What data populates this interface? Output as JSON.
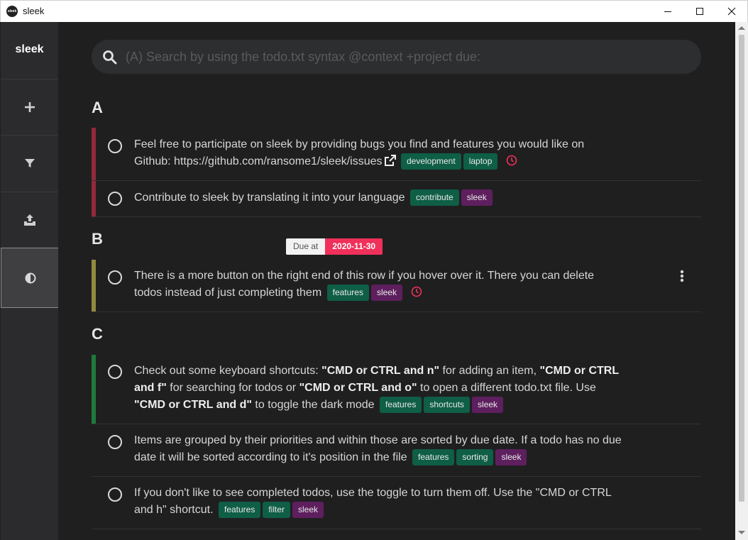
{
  "window": {
    "title": "sleek",
    "icon_label": "sleek"
  },
  "sidebar": {
    "brand": "sleek",
    "buttons": [
      {
        "name": "add",
        "icon": "plus-icon"
      },
      {
        "name": "filter",
        "icon": "funnel-icon"
      },
      {
        "name": "upload",
        "icon": "upload-icon"
      },
      {
        "name": "theme",
        "icon": "contrast-icon",
        "active": true
      }
    ]
  },
  "search": {
    "placeholder": "(A) Search by using the todo.txt syntax @context +project due:"
  },
  "groups": [
    {
      "priority": "A",
      "color": "#922a3c",
      "items": [
        {
          "text": "Feel free to participate on sleek by providing bugs you find and features you would like on Github: https://github.com/ransome1/sleek/issues",
          "contexts": [
            "development",
            "laptop"
          ],
          "projects": [],
          "has_link": true,
          "has_due": true
        },
        {
          "text": "Contribute to sleek by translating it into your language",
          "contexts": [
            "contribute"
          ],
          "projects": [
            "sleek"
          ]
        }
      ]
    },
    {
      "priority": "B",
      "color": "#928a40",
      "items": [
        {
          "text": "There is a more button on the right end of this row if you hover over it. There you can delete todos instead of just completing them",
          "contexts": [
            "features"
          ],
          "projects": [
            "sleek"
          ],
          "has_due": true,
          "hovered": true
        }
      ]
    },
    {
      "priority": "C",
      "color": "#1e7a3c",
      "items": [
        {
          "text_parts": [
            "Check out some keyboard shortcuts: ",
            "\"CMD or CTRL and n\"",
            " for adding an item, ",
            "\"CMD or CTRL and f\"",
            " for searching for todos or ",
            "\"CMD or CTRL and o\"",
            " to open a different todo.txt file. Use ",
            "\"CMD or CTRL and d\"",
            " to toggle the dark mode"
          ],
          "contexts": [
            "features",
            "shortcuts"
          ],
          "projects": [
            "sleek"
          ]
        },
        {
          "text": "Items are grouped by their priorities and within those are sorted by due date. If a todo has no due date it will be sorted according to it's position in the file",
          "contexts": [
            "features",
            "sorting"
          ],
          "projects": [
            "sleek"
          ]
        },
        {
          "text": "If you don't like to see completed todos, use the toggle to turn them off. Use the \"CMD or CTRL and h\" shortcut.",
          "contexts": [
            "features",
            "filter"
          ],
          "projects": [
            "sleek"
          ]
        }
      ]
    }
  ],
  "tooltip": {
    "label": "Due at",
    "value": "2020-11-30"
  },
  "colors": {
    "context_tag": "#0f5e46",
    "project_tag": "#5e1f5e",
    "due_alarm": "#f0305a"
  }
}
